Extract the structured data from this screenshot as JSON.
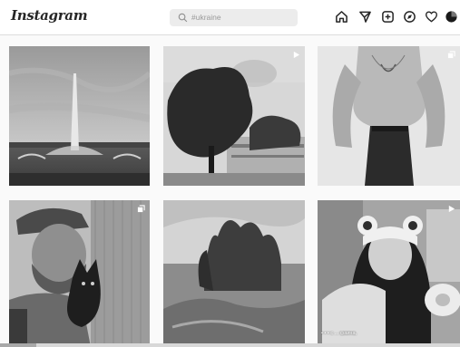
{
  "header": {
    "logo": "Instagram",
    "search": {
      "placeholder": "#ukraine"
    },
    "nav_icons": [
      "home-icon",
      "direct-send-icon",
      "new-post-icon",
      "explore-compass-icon",
      "activity-heart-icon",
      "profile-avatar-icon"
    ]
  },
  "grid": {
    "tiles": [
      {
        "name": "fountain-photo",
        "badge": ""
      },
      {
        "name": "trees-building-photo",
        "badge": "video-icon"
      },
      {
        "name": "fashion-photo",
        "badge": "multiple-posts-icon"
      },
      {
        "name": "man-with-cat-photo",
        "badge": "multiple-posts-icon"
      },
      {
        "name": "landscape-photo",
        "badge": ""
      },
      {
        "name": "girl-bear-ears-photo",
        "badge": "video-icon",
        "caption": "• • •  с ... фаина, "
      }
    ]
  },
  "colors": {
    "icon": "#262626",
    "header_bg": "#ffffff",
    "page_bg": "#fafafa"
  }
}
